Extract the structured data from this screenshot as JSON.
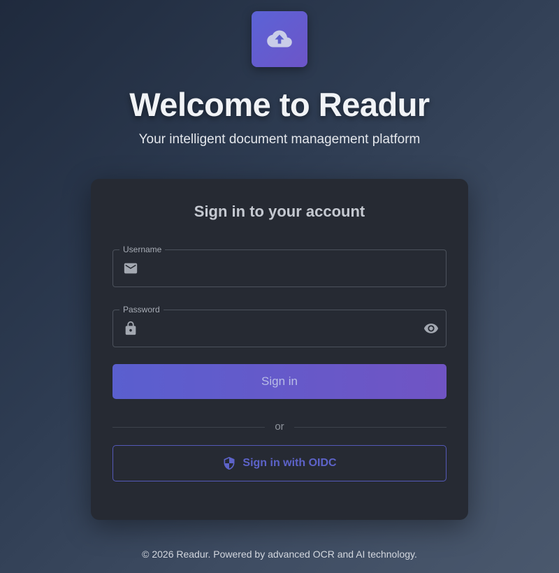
{
  "app": {
    "title": "Welcome to Readur",
    "subtitle": "Your intelligent document management platform",
    "logo_icon": "cloud-upload-icon",
    "accent_color": "#5b63d6"
  },
  "login": {
    "heading": "Sign in to your account",
    "username": {
      "label": "Username",
      "value": "",
      "placeholder": "",
      "icon": "mail-icon"
    },
    "password": {
      "label": "Password",
      "value": "",
      "placeholder": "",
      "icon": "lock-icon",
      "toggle_icon": "eye-icon"
    },
    "signin_label": "Sign in",
    "divider_text": "or",
    "oidc_label": "Sign in with OIDC",
    "oidc_icon": "shield-icon"
  },
  "footer": {
    "text": "© 2026 Readur. Powered by advanced OCR and AI technology."
  }
}
